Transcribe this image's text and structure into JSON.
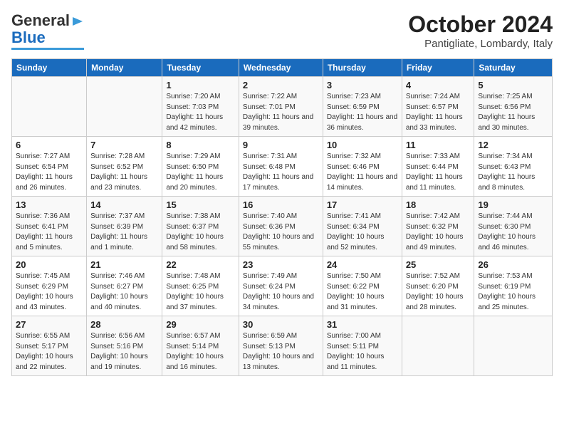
{
  "logo": {
    "general": "General",
    "blue": "Blue"
  },
  "title": "October 2024",
  "subtitle": "Pantigliate, Lombardy, Italy",
  "days_of_week": [
    "Sunday",
    "Monday",
    "Tuesday",
    "Wednesday",
    "Thursday",
    "Friday",
    "Saturday"
  ],
  "weeks": [
    [
      {
        "num": "",
        "info": ""
      },
      {
        "num": "",
        "info": ""
      },
      {
        "num": "1",
        "info": "Sunrise: 7:20 AM\nSunset: 7:03 PM\nDaylight: 11 hours and 42 minutes."
      },
      {
        "num": "2",
        "info": "Sunrise: 7:22 AM\nSunset: 7:01 PM\nDaylight: 11 hours and 39 minutes."
      },
      {
        "num": "3",
        "info": "Sunrise: 7:23 AM\nSunset: 6:59 PM\nDaylight: 11 hours and 36 minutes."
      },
      {
        "num": "4",
        "info": "Sunrise: 7:24 AM\nSunset: 6:57 PM\nDaylight: 11 hours and 33 minutes."
      },
      {
        "num": "5",
        "info": "Sunrise: 7:25 AM\nSunset: 6:56 PM\nDaylight: 11 hours and 30 minutes."
      }
    ],
    [
      {
        "num": "6",
        "info": "Sunrise: 7:27 AM\nSunset: 6:54 PM\nDaylight: 11 hours and 26 minutes."
      },
      {
        "num": "7",
        "info": "Sunrise: 7:28 AM\nSunset: 6:52 PM\nDaylight: 11 hours and 23 minutes."
      },
      {
        "num": "8",
        "info": "Sunrise: 7:29 AM\nSunset: 6:50 PM\nDaylight: 11 hours and 20 minutes."
      },
      {
        "num": "9",
        "info": "Sunrise: 7:31 AM\nSunset: 6:48 PM\nDaylight: 11 hours and 17 minutes."
      },
      {
        "num": "10",
        "info": "Sunrise: 7:32 AM\nSunset: 6:46 PM\nDaylight: 11 hours and 14 minutes."
      },
      {
        "num": "11",
        "info": "Sunrise: 7:33 AM\nSunset: 6:44 PM\nDaylight: 11 hours and 11 minutes."
      },
      {
        "num": "12",
        "info": "Sunrise: 7:34 AM\nSunset: 6:43 PM\nDaylight: 11 hours and 8 minutes."
      }
    ],
    [
      {
        "num": "13",
        "info": "Sunrise: 7:36 AM\nSunset: 6:41 PM\nDaylight: 11 hours and 5 minutes."
      },
      {
        "num": "14",
        "info": "Sunrise: 7:37 AM\nSunset: 6:39 PM\nDaylight: 11 hours and 1 minute."
      },
      {
        "num": "15",
        "info": "Sunrise: 7:38 AM\nSunset: 6:37 PM\nDaylight: 10 hours and 58 minutes."
      },
      {
        "num": "16",
        "info": "Sunrise: 7:40 AM\nSunset: 6:36 PM\nDaylight: 10 hours and 55 minutes."
      },
      {
        "num": "17",
        "info": "Sunrise: 7:41 AM\nSunset: 6:34 PM\nDaylight: 10 hours and 52 minutes."
      },
      {
        "num": "18",
        "info": "Sunrise: 7:42 AM\nSunset: 6:32 PM\nDaylight: 10 hours and 49 minutes."
      },
      {
        "num": "19",
        "info": "Sunrise: 7:44 AM\nSunset: 6:30 PM\nDaylight: 10 hours and 46 minutes."
      }
    ],
    [
      {
        "num": "20",
        "info": "Sunrise: 7:45 AM\nSunset: 6:29 PM\nDaylight: 10 hours and 43 minutes."
      },
      {
        "num": "21",
        "info": "Sunrise: 7:46 AM\nSunset: 6:27 PM\nDaylight: 10 hours and 40 minutes."
      },
      {
        "num": "22",
        "info": "Sunrise: 7:48 AM\nSunset: 6:25 PM\nDaylight: 10 hours and 37 minutes."
      },
      {
        "num": "23",
        "info": "Sunrise: 7:49 AM\nSunset: 6:24 PM\nDaylight: 10 hours and 34 minutes."
      },
      {
        "num": "24",
        "info": "Sunrise: 7:50 AM\nSunset: 6:22 PM\nDaylight: 10 hours and 31 minutes."
      },
      {
        "num": "25",
        "info": "Sunrise: 7:52 AM\nSunset: 6:20 PM\nDaylight: 10 hours and 28 minutes."
      },
      {
        "num": "26",
        "info": "Sunrise: 7:53 AM\nSunset: 6:19 PM\nDaylight: 10 hours and 25 minutes."
      }
    ],
    [
      {
        "num": "27",
        "info": "Sunrise: 6:55 AM\nSunset: 5:17 PM\nDaylight: 10 hours and 22 minutes."
      },
      {
        "num": "28",
        "info": "Sunrise: 6:56 AM\nSunset: 5:16 PM\nDaylight: 10 hours and 19 minutes."
      },
      {
        "num": "29",
        "info": "Sunrise: 6:57 AM\nSunset: 5:14 PM\nDaylight: 10 hours and 16 minutes."
      },
      {
        "num": "30",
        "info": "Sunrise: 6:59 AM\nSunset: 5:13 PM\nDaylight: 10 hours and 13 minutes."
      },
      {
        "num": "31",
        "info": "Sunrise: 7:00 AM\nSunset: 5:11 PM\nDaylight: 10 hours and 11 minutes."
      },
      {
        "num": "",
        "info": ""
      },
      {
        "num": "",
        "info": ""
      }
    ]
  ]
}
